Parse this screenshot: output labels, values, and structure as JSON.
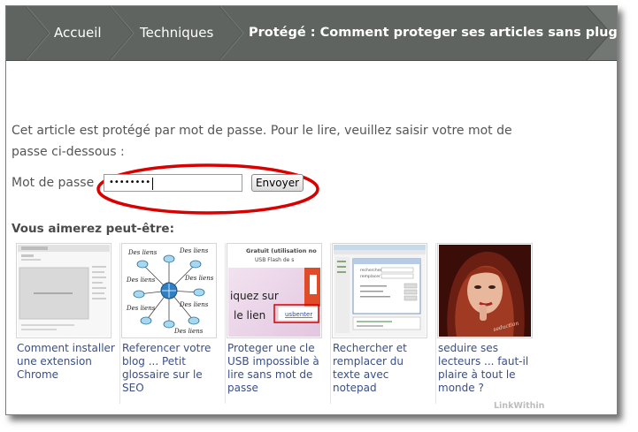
{
  "breadcrumb": {
    "items": [
      "Accueil",
      "Techniques",
      "Protégé : Comment proteger ses articles sans plugin"
    ]
  },
  "protected": {
    "notice": "Cet article est protégé par mot de passe. Pour le lire, veuillez saisir votre mot de passe ci-dessous :",
    "password_label": "Mot de passe",
    "password_value": "••••••••",
    "submit_label": "Envoyer"
  },
  "related": {
    "title": "Vous aimerez peut-être:",
    "items": [
      {
        "caption": "Comment installer une extension Chrome",
        "icon": "screenshot-thumbnail"
      },
      {
        "caption": "Referencer votre blog ... Petit glossaire sur le SEO",
        "icon": "network-diagram-thumbnail"
      },
      {
        "caption": "Proteger une cle USB impossible à lire sans mot de passe",
        "icon": "usb-tutorial-thumbnail",
        "thumb_text": "Gratuit (utilisation no USB Flash de s iquez sur le lien usbenter"
      },
      {
        "caption": "Rechercher et remplacer du texte avec notepad",
        "icon": "notepad-dialog-thumbnail"
      },
      {
        "caption": "seduire ses lecteurs ... faut-il plaire à tout le monde ?",
        "icon": "portrait-photo-thumbnail"
      }
    ],
    "branding": "LinkWithin"
  },
  "colors": {
    "breadcrumb_bg": "#5f6461",
    "link": "#3a4f84",
    "highlight_ellipse": "#d90000"
  }
}
